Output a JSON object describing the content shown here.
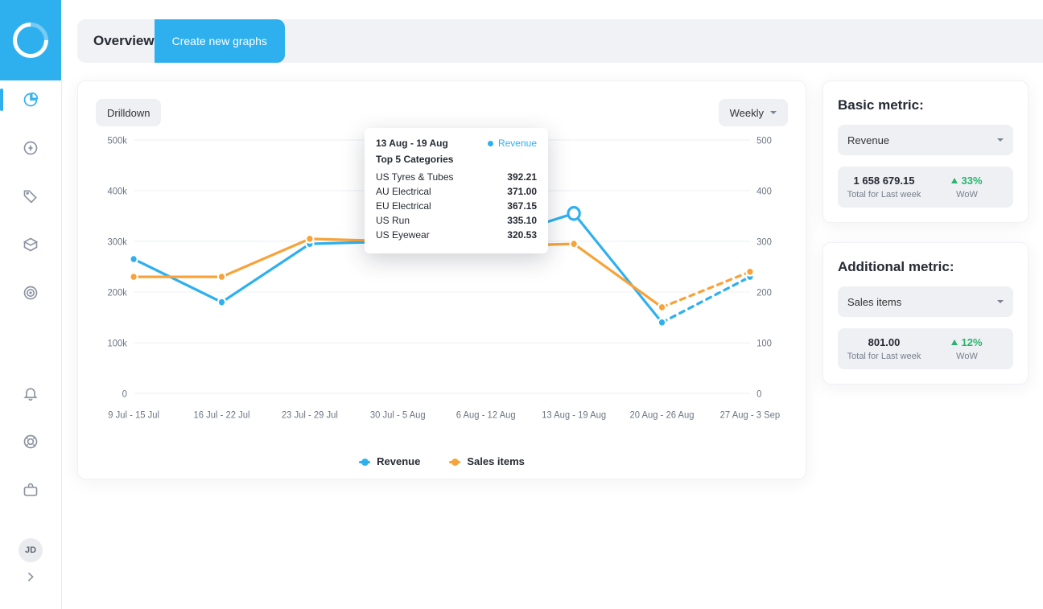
{
  "colors": {
    "blue": "#2eb0ef",
    "orange": "#f7a33a",
    "green": "#2ab46b"
  },
  "header": {
    "title": "Overview",
    "cta": "Create new graphs"
  },
  "sidebar": {
    "items": [
      {
        "name": "overview",
        "active": true
      },
      {
        "name": "transactions"
      },
      {
        "name": "tags"
      },
      {
        "name": "inventory"
      },
      {
        "name": "targets"
      }
    ],
    "footer_items": [
      {
        "name": "notifications"
      },
      {
        "name": "support"
      },
      {
        "name": "workspace"
      }
    ],
    "avatar": "JD"
  },
  "chart_toolbar": {
    "drilldown": "Drilldown",
    "period": "Weekly"
  },
  "tooltip": {
    "date_range": "13 Aug - 19 Aug",
    "metric_label": "Revenue",
    "section_title": "Top 5 Categories",
    "rows": [
      {
        "label": "US Tyres & Tubes",
        "value": "392.21"
      },
      {
        "label": "AU Electrical",
        "value": "371.00"
      },
      {
        "label": "EU Electrical",
        "value": "367.15"
      },
      {
        "label": "US Run",
        "value": "335.10"
      },
      {
        "label": "US Eyewear",
        "value": "320.53"
      }
    ]
  },
  "legend": {
    "series1": "Revenue",
    "series2": "Sales items"
  },
  "metrics": {
    "basic": {
      "title": "Basic metric:",
      "selected": "Revenue",
      "value": "1 658 679.15",
      "value_label": "Total for Last week",
      "delta": "33%",
      "delta_label": "WoW"
    },
    "additional": {
      "title": "Additional metric:",
      "selected": "Sales items",
      "value": "801.00",
      "value_label": "Total for Last week",
      "delta": "12%",
      "delta_label": "WoW"
    }
  },
  "chart_data": {
    "type": "line",
    "title": "",
    "xlabel": "",
    "ylabel_left": "Revenue",
    "ylabel_right": "Sales items",
    "categories": [
      "9 Jul - 15 Jul",
      "16 Jul - 22 Jul",
      "23 Jul - 29 Jul",
      "30 Jul - 5 Aug",
      "6 Aug - 12 Aug",
      "13 Aug - 19 Aug",
      "20 Aug - 26 Aug",
      "27 Aug - 3 Sep"
    ],
    "y_left_ticks": [
      0,
      "100k",
      "200k",
      "300k",
      "400k",
      "500k"
    ],
    "y_left_range": [
      0,
      500000
    ],
    "y_right_ticks": [
      0,
      100,
      200,
      300,
      400,
      500
    ],
    "y_right_range": [
      0,
      500
    ],
    "series": [
      {
        "name": "Revenue",
        "axis": "left",
        "color": "#2eb0ef",
        "values": [
          265000,
          180000,
          295000,
          300000,
          300000,
          355000,
          140000,
          230000
        ],
        "dashed_from_index": 6
      },
      {
        "name": "Sales items",
        "axis": "right",
        "color": "#f7a33a",
        "values": [
          230,
          230,
          305,
          300,
          290,
          295,
          170,
          240
        ],
        "dashed_from_index": 6
      }
    ],
    "highlight_index": 5
  }
}
